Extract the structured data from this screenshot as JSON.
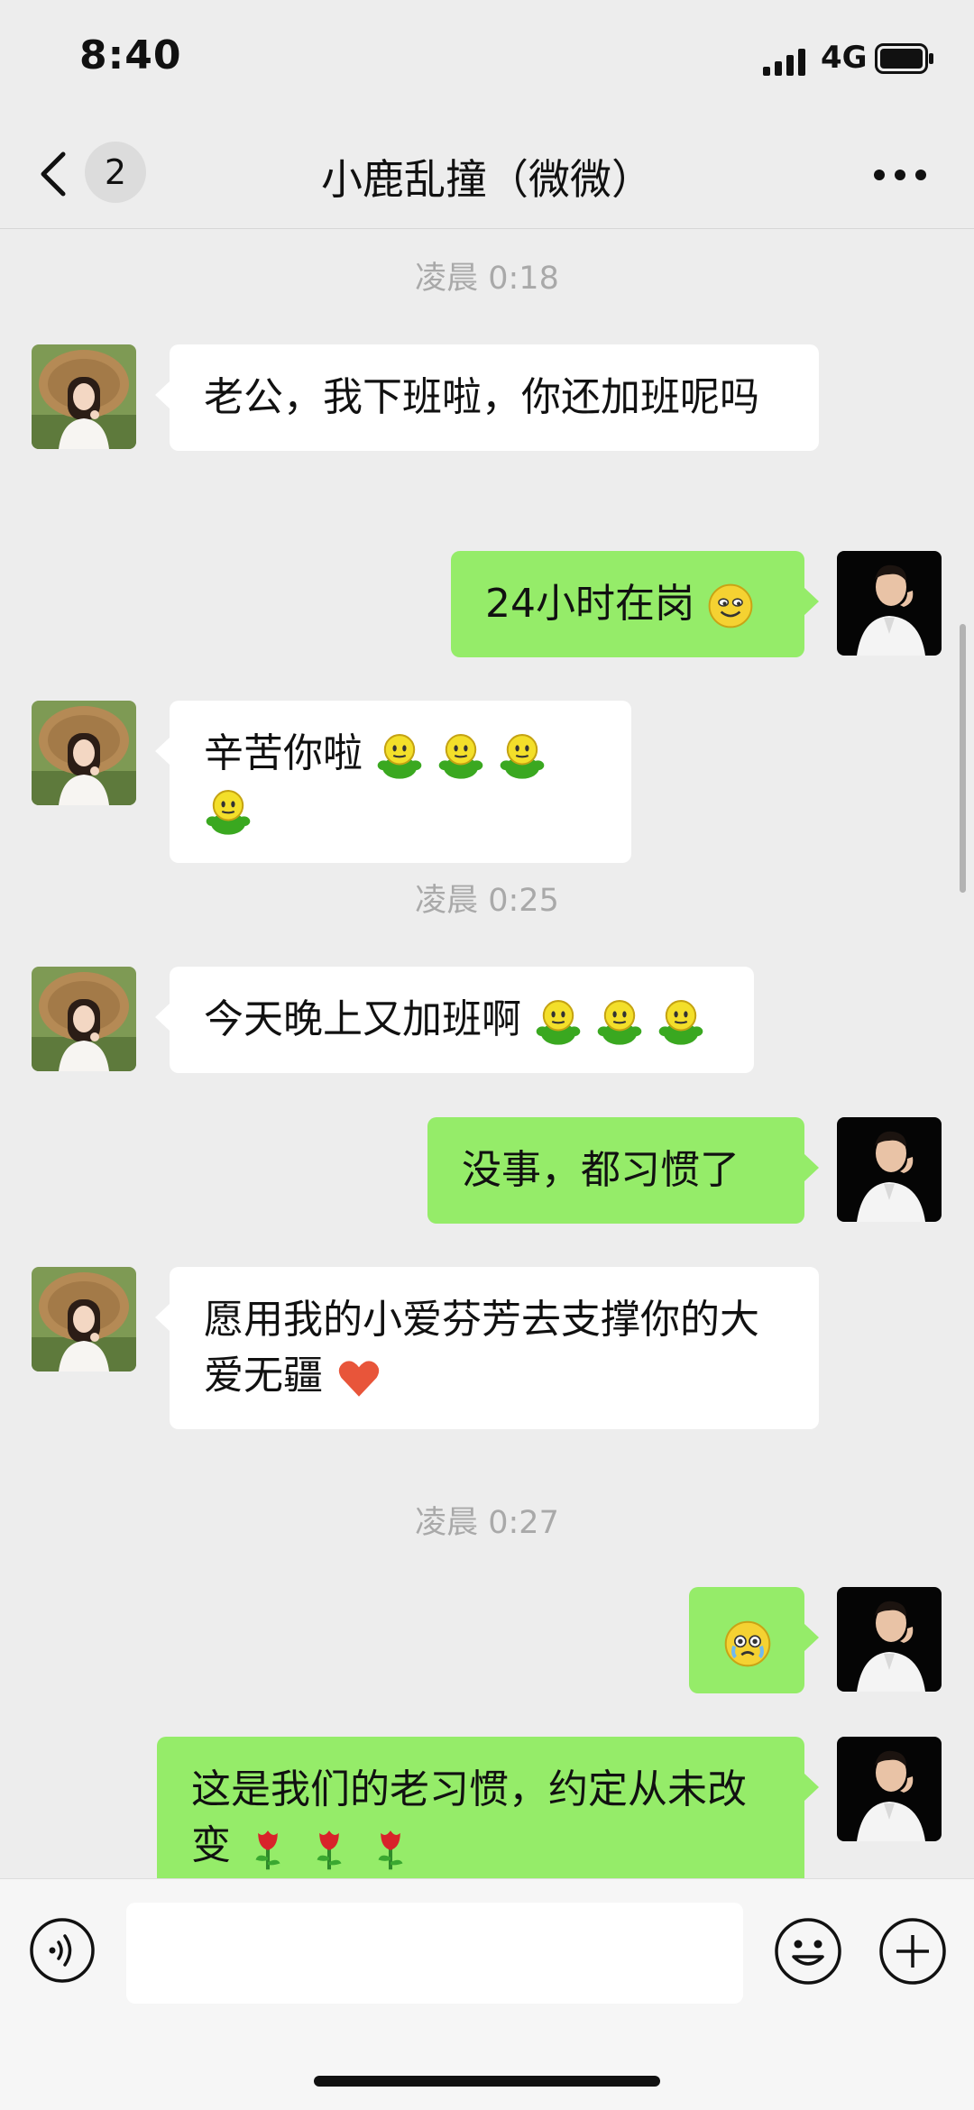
{
  "status_bar": {
    "time": "8:40",
    "network": "4G"
  },
  "nav": {
    "back_badge": "2",
    "title": "小鹿乱撞（微微）"
  },
  "timestamps": [
    "凌晨 0:18",
    "凌晨 0:25",
    "凌晨 0:27"
  ],
  "messages": [
    {
      "side": "left",
      "text": "老公，我下班啦，你还加班呢吗",
      "emojis": []
    },
    {
      "side": "right",
      "text": "24小时在岗",
      "emojis": [
        "smile-emoji"
      ]
    },
    {
      "side": "left",
      "text": "辛苦你啦",
      "emojis": [
        "green-frog-emoji",
        "green-frog-emoji",
        "green-frog-emoji",
        "green-frog-emoji"
      ]
    },
    {
      "side": "left",
      "text": "今天晚上又加班啊",
      "emojis": [
        "green-frog-emoji",
        "green-frog-emoji",
        "green-frog-emoji"
      ]
    },
    {
      "side": "right",
      "text": "没事，都习惯了",
      "emojis": []
    },
    {
      "side": "left",
      "text": "愿用我的小爱芬芳去支撑你的大爱无疆",
      "emojis": [
        "heart-emoji"
      ]
    },
    {
      "side": "right",
      "text": "",
      "emojis": [
        "teary-emoji"
      ]
    },
    {
      "side": "right",
      "text": "这是我们的老习惯，约定从未改变",
      "emojis": [
        "rose-emoji",
        "rose-emoji",
        "rose-emoji"
      ]
    }
  ],
  "colors": {
    "background": "#ededed",
    "sent_bubble": "#95ec69",
    "received_bubble": "#ffffff",
    "timestamp": "#a9a9a9"
  },
  "icons": [
    "back-arrow-icon",
    "more-icon",
    "voice-icon",
    "emoji-icon",
    "plus-icon"
  ]
}
